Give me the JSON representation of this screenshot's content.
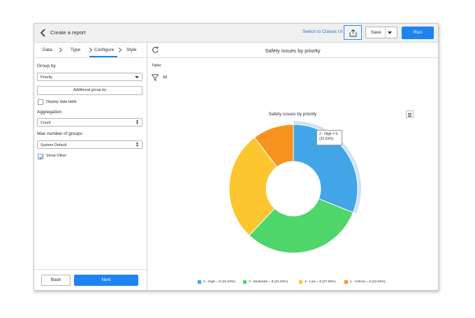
{
  "header": {
    "title": "Create a report",
    "switch_link": "Switch to Classic UI",
    "save_label": "Save",
    "run_label": "Run"
  },
  "steps": [
    {
      "label": "Data",
      "active": false
    },
    {
      "label": "Type",
      "active": false
    },
    {
      "label": "Configure",
      "active": true
    },
    {
      "label": "Style",
      "active": false
    }
  ],
  "config": {
    "group_by_label": "Group by",
    "group_by_value": "Priority",
    "additional_group_by": "Additional group by",
    "display_data_table": "Display data table",
    "display_data_table_checked": false,
    "aggregation_label": "Aggregation",
    "aggregation_value": "Count",
    "max_groups_label": "Max number of groups",
    "max_groups_value": "System Default",
    "show_other": "Show Other",
    "show_other_checked": true
  },
  "footer": {
    "back_label": "Back",
    "next_label": "Next"
  },
  "main": {
    "title": "Safety issues by priority",
    "table_label": "Table:",
    "filter_value": "All"
  },
  "tooltip": {
    "line1": "2 - High = 9",
    "line2": "(31.03%)"
  },
  "colors": {
    "accent": "#1e84ef",
    "high": "#42a5e8",
    "moderate": "#4fd66a",
    "low": "#fbc62f",
    "critical": "#f7931e"
  },
  "chart_data": {
    "type": "pie",
    "title": "Safety issues by priority",
    "donut": true,
    "categories": [
      "2 - High",
      "3 - Moderate",
      "4 - Low",
      "1 - Critical"
    ],
    "values": [
      9,
      9,
      8,
      3
    ],
    "percentages": [
      31.03,
      31.03,
      27.59,
      10.34
    ],
    "legend": [
      "2 - High = 9 (31.03%)",
      "3 - Moderate = 9 (31.03%)",
      "4 - Low = 8 (27.59%)",
      "1 - Critical = 3 (10.34%)"
    ],
    "legend_position": "bottom",
    "highlighted": "2 - High"
  }
}
